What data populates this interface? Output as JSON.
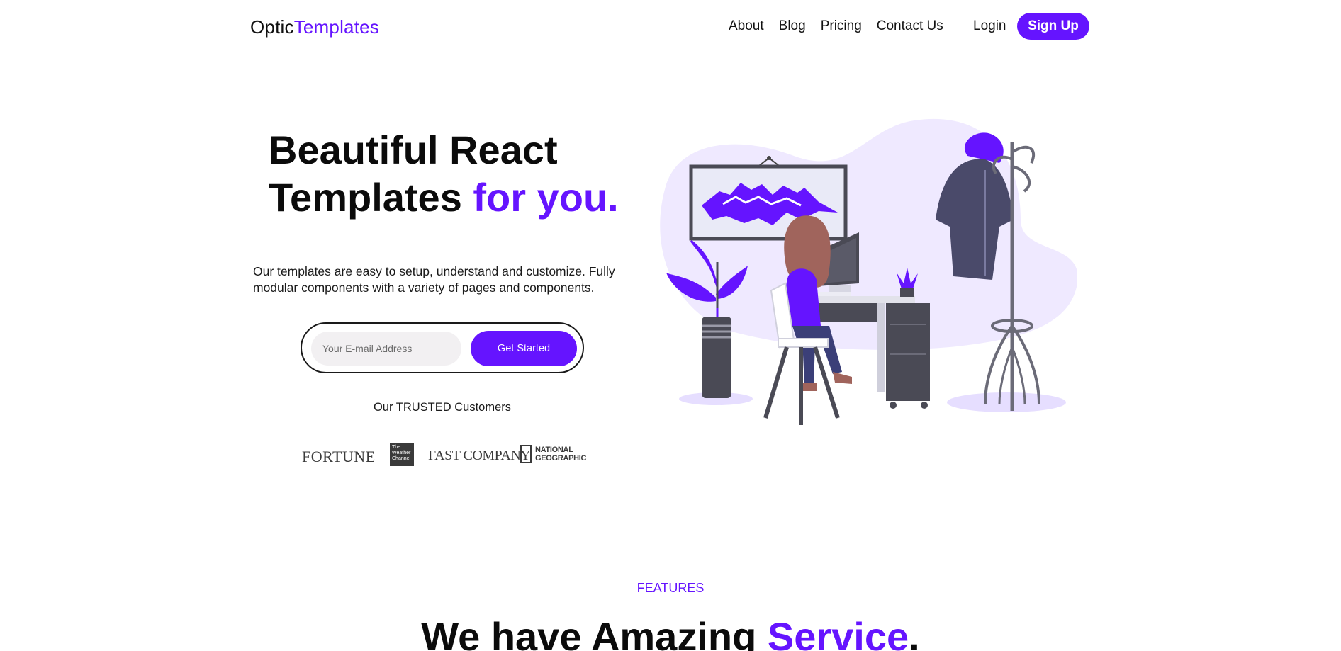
{
  "header": {
    "logo_primary": "Optic",
    "logo_accent": "Templates",
    "nav": [
      "About",
      "Blog",
      "Pricing",
      "Contact Us"
    ],
    "login_label": "Login",
    "signup_label": "Sign Up"
  },
  "hero": {
    "title_line1": "Beautiful React",
    "title_line2_plain": "Templates ",
    "title_line2_accent": "for you.",
    "description": "Our templates are easy to setup, understand and customize. Fully modular components with a variety of pages and components.",
    "email_placeholder": "Your E-mail Address",
    "cta_label": "Get Started",
    "trusted_label": "Our TRUSTED Customers",
    "customers": {
      "fortune": "FORTUNE",
      "weather": "The Weather Channel",
      "fastco": "FAST COMPANY",
      "natgeo": "NATIONAL GEOGRAPHIC"
    }
  },
  "features": {
    "label": "FEATURES",
    "title_plain": "We have Amazing ",
    "title_accent": "Service",
    "title_end": "."
  },
  "colors": {
    "accent": "#6514ff",
    "text": "#111111",
    "illustration_bg": "#efe9ff"
  }
}
